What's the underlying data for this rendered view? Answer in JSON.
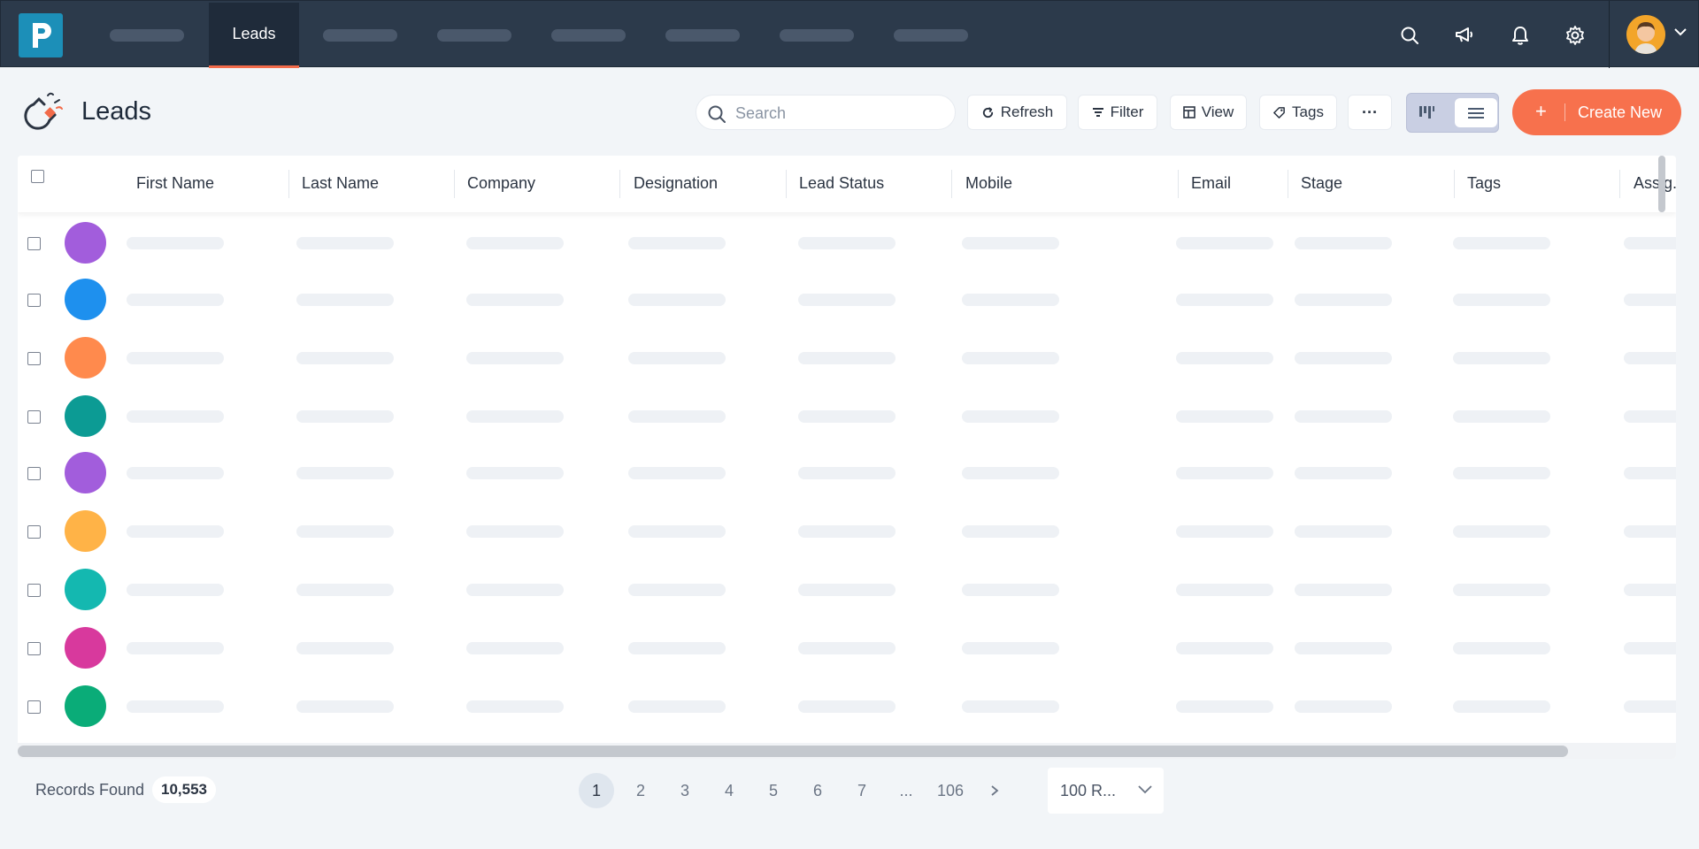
{
  "nav": {
    "active_tab": "Leads",
    "icons": [
      "search-icon",
      "megaphone-icon",
      "bell-icon",
      "gear-icon"
    ]
  },
  "page": {
    "title": "Leads"
  },
  "toolbar": {
    "search_placeholder": "Search",
    "refresh_label": "Refresh",
    "filter_label": "Filter",
    "view_label": "View",
    "tags_label": "Tags",
    "more_label": "···",
    "create_label": "Create New",
    "create_icon": "+"
  },
  "table": {
    "columns": [
      "First Name",
      "Last Name",
      "Company",
      "Designation",
      "Lead Status",
      "Mobile",
      "Email",
      "Stage",
      "Tags",
      "Assig..."
    ],
    "row_avatar_colors": [
      "#a25ddc",
      "#1e90ee",
      "#ff8a4d",
      "#0c9b94",
      "#a25ddc",
      "#ffb347",
      "#14b8b0",
      "#d8399d",
      "#0aac78",
      "#ffb347"
    ]
  },
  "footer": {
    "records_label": "Records Found",
    "records_count": "10,553",
    "pages": [
      "1",
      "2",
      "3",
      "4",
      "5",
      "6",
      "7",
      "...",
      "106"
    ],
    "current_page": "1",
    "per_page": "100 R..."
  },
  "colors": {
    "navbar": "#2c3a4b",
    "accent": "#f7714d",
    "logo": "#1c8fb8"
  }
}
